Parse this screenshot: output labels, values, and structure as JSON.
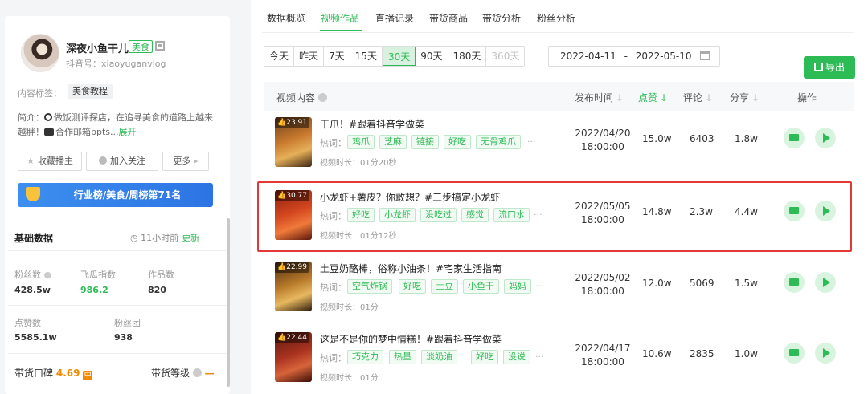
{
  "profile": {
    "name": "深夜小鱼干儿",
    "category_tag": "美食",
    "douyin_id": "抖音号：xiaoyuganvlog",
    "content_tag_label": "内容标签：",
    "content_tag": "美食教程",
    "bio_prefix": "简介：",
    "bio_text": "做饭测评探店，在追寻美食的道路上越来越胖！",
    "bio_text2": "合作邮箱ppts...",
    "expand": "展开"
  },
  "actions": {
    "favorite": "收藏播主",
    "follow": "加入关注",
    "more": "更多"
  },
  "rank": "行业榜/美食/周榜第71名",
  "basic": {
    "title": "基础数据",
    "updated": "11小时前",
    "refresh": "更新",
    "fans_label": "粉丝数",
    "fans": "428.5w",
    "feigua_label": "飞瓜指数",
    "feigua": "986.2",
    "works_label": "作品数",
    "works": "820",
    "likes_label": "点赞数",
    "likes": "5585.1w",
    "fan_group_label": "粉丝团",
    "fan_group": "938",
    "koubei_label": "带货口碑",
    "koubei_score": "4.69",
    "koubei_level": "中",
    "grade_label": "带货等级",
    "grade_value": "—"
  },
  "tabs": [
    "数据概览",
    "视频作品",
    "直播记录",
    "带货商品",
    "带货分析",
    "粉丝分析"
  ],
  "ranges": [
    "今天",
    "昨天",
    "7天",
    "15天",
    "30天",
    "90天",
    "180天",
    "360天"
  ],
  "date_range": {
    "start": "2022-04-11",
    "sep": "-",
    "end": "2022-05-10"
  },
  "export": "导出",
  "headers": {
    "content": "视频内容",
    "publish": "发布时间",
    "likes": "点赞",
    "comments": "评论",
    "shares": "分享",
    "ops": "操作"
  },
  "hot_label": "热词：",
  "videos": [
    {
      "score": "23.91",
      "title": "干爪！#跟着抖音学做菜",
      "hot": [
        "鸡爪",
        "芝麻",
        "链接",
        "好吃",
        "无骨鸡爪"
      ],
      "more": "···",
      "duration": "视频时长：01分20秒",
      "date": "2022/04/20",
      "time": "18:00:00",
      "likes": "15.0w",
      "comments": "6403",
      "shares": "1.8w"
    },
    {
      "score": "30.77",
      "title": "小龙虾+薯皮？你敢想？#三步搞定小龙虾",
      "hot": [
        "好吃",
        "小龙虾",
        "没吃过",
        "感觉",
        "流口水"
      ],
      "more": "···",
      "duration": "视频时长：01分12秒",
      "date": "2022/05/05",
      "time": "18:00:00",
      "likes": "14.8w",
      "comments": "2.3w",
      "shares": "4.4w"
    },
    {
      "score": "22.99",
      "title": "土豆奶酪棒，俗称小油条！#宅家生活指南",
      "hot": [
        "空气炸锅",
        "好吃",
        "土豆",
        "小鱼干",
        "妈妈"
      ],
      "more": "···",
      "duration": "视频时长：01分",
      "date": "2022/05/02",
      "time": "18:00:00",
      "likes": "12.0w",
      "comments": "5069",
      "shares": "1.5w"
    },
    {
      "score": "22.44",
      "title": "这是不是你的梦中情糕！#跟着抖音学做菜",
      "hot": [
        "巧克力",
        "热量",
        "淡奶油",
        "好吃",
        "没说"
      ],
      "more": "···",
      "duration": "视频时长：01分",
      "date": "2022/04/17",
      "time": "18:00:00",
      "likes": "10.6w",
      "comments": "2835",
      "shares": "1.0w"
    }
  ],
  "colors": {
    "accent": "#2dbb55",
    "highlight": "#e53935",
    "rank_blue": "#2c74e3",
    "orange": "#f08a00"
  }
}
